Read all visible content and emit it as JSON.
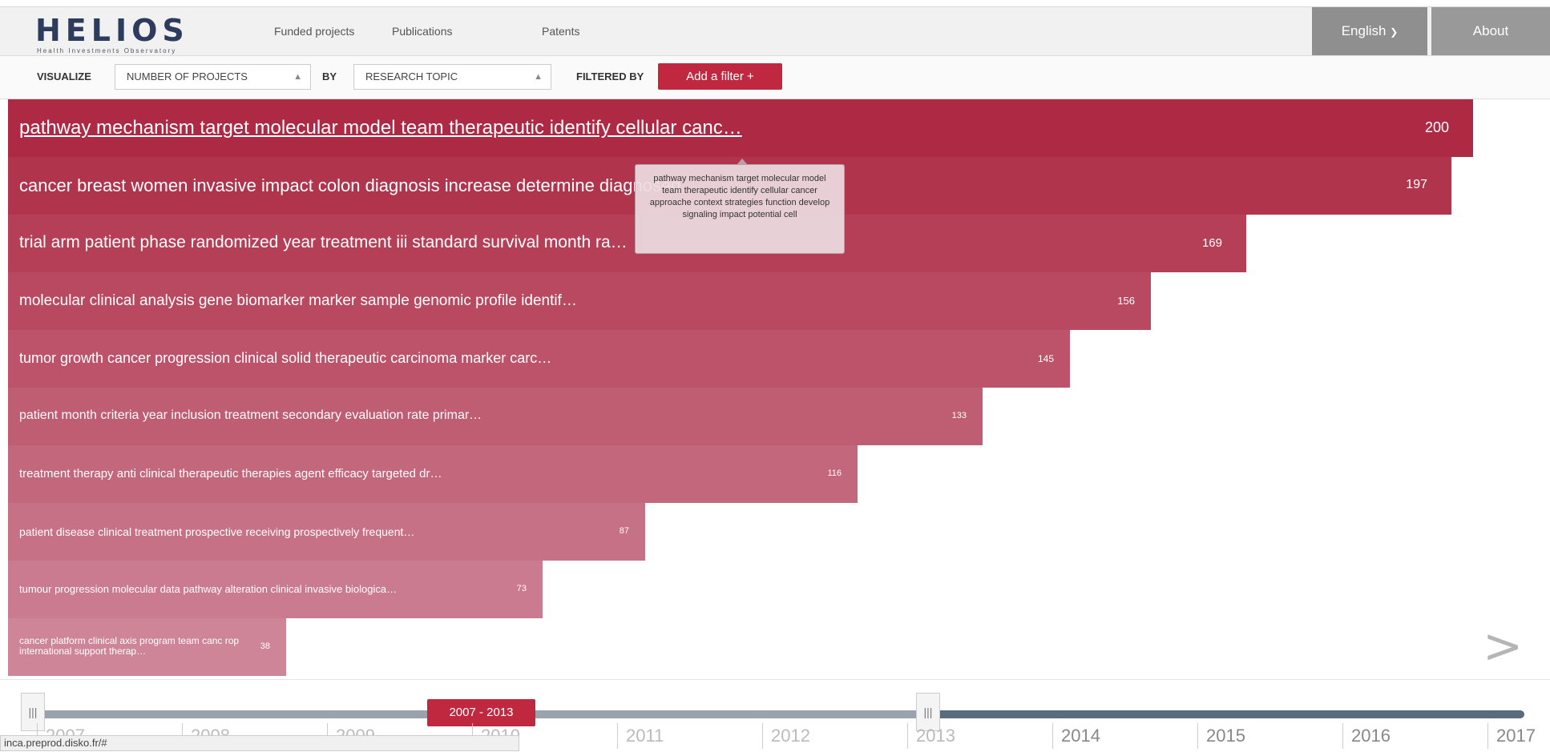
{
  "app": {
    "logo_text": "HELIOS",
    "logo_subtitle": "Health Investments Observatory"
  },
  "nav": {
    "links": [
      "Funded projects",
      "Publications",
      "Patents"
    ],
    "language": "English",
    "about": "About"
  },
  "filterbar": {
    "visualize_label": "VISUALIZE",
    "visualize_value": "NUMBER OF PROJECTS",
    "by_label": "BY",
    "by_value": "RESEARCH TOPIC",
    "filtered_by_label": "FILTERED BY",
    "add_filter": "Add a filter  +"
  },
  "chart_data": {
    "type": "bar",
    "orientation": "horizontal",
    "max": 200,
    "bars": [
      {
        "label": "pathway mechanism target molecular model team therapeutic identify cellular canc…",
        "value": 200,
        "color": "#ae2a44"
      },
      {
        "label": "cancer breast women invasive impact colon diagnosis increase determine diagnosed…",
        "value": 197,
        "color": "#b1344d"
      },
      {
        "label": "trial arm patient phase randomized year treatment iii standard survival month ra…",
        "value": 169,
        "color": "#b53f57"
      },
      {
        "label": "molecular clinical analysis gene biomarker marker sample genomic profile identif…",
        "value": 156,
        "color": "#b84960"
      },
      {
        "label": "tumor growth cancer progression clinical solid therapeutic carcinoma marker carc…",
        "value": 145,
        "color": "#bc536a"
      },
      {
        "label": "patient month criteria year inclusion treatment secondary evaluation rate primar…",
        "value": 133,
        "color": "#bf5d73"
      },
      {
        "label": "treatment therapy anti clinical therapeutic therapies agent efficacy targeted dr…",
        "value": 116,
        "color": "#c3677c"
      },
      {
        "label": "patient disease clinical treatment prospective receiving prospectively frequent…",
        "value": 87,
        "color": "#c77186"
      },
      {
        "label": "tumour progression molecular data pathway alteration clinical invasive biologica…",
        "value": 73,
        "color": "#cb7b8f"
      },
      {
        "label": "cancer platform clinical axis program team canc rop international support therap…",
        "value": 38,
        "color": "#cf8598"
      }
    ]
  },
  "tooltip": {
    "text": "pathway mechanism target molecular model team therapeutic identify cellular cancer approache context strategies function develop signaling impact potential cell"
  },
  "next_arrow": ">",
  "timeline": {
    "range_label": "2007 - 2013",
    "years": [
      "2007",
      "2008",
      "2009",
      "2010",
      "2011",
      "2012",
      "2013",
      "2014",
      "2015",
      "2016",
      "2017"
    ],
    "selected_start": "2007",
    "selected_end": "2013"
  },
  "statusbar": "inca.preprod.disko.fr/#"
}
